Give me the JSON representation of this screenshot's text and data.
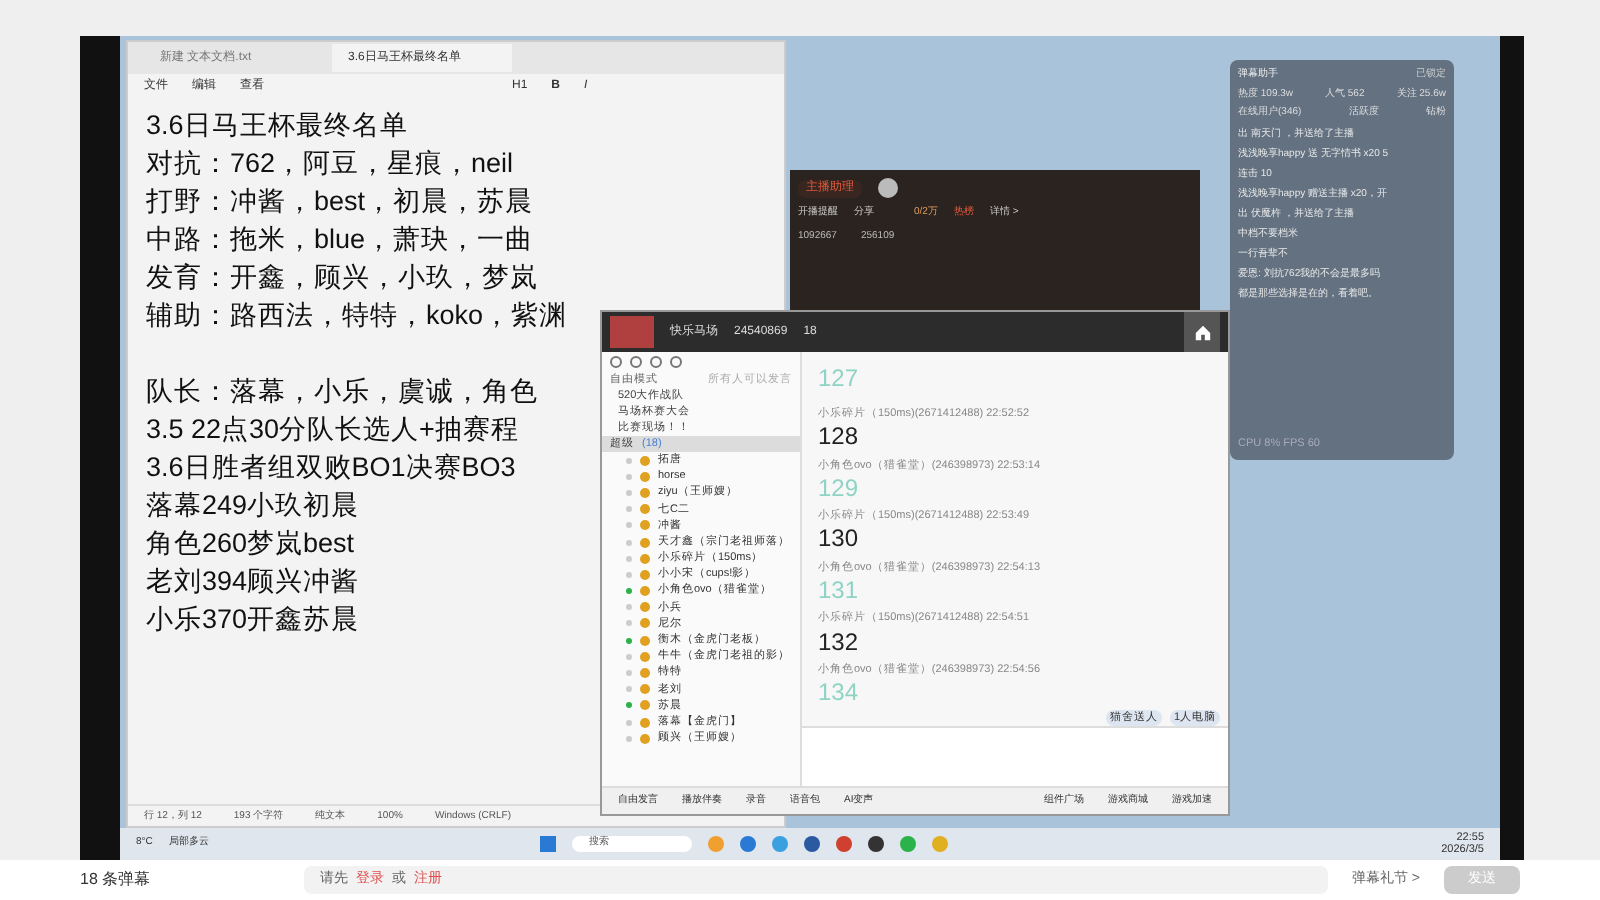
{
  "notepad": {
    "tabs": [
      {
        "label": "新建 文本文档.txt",
        "selected": false
      },
      {
        "label": "3.6日马王杯最终名单",
        "selected": true
      }
    ],
    "menu": [
      "文件",
      "编辑",
      "查看"
    ],
    "toolbar": [
      "H1",
      "B",
      "I"
    ],
    "paragraphs": [
      [
        "3.6日马王杯最终名单",
        "对抗：762，阿豆，星痕，neil",
        "打野：冲酱，best，初晨，苏晨",
        "中路：拖米，blue，萧玦，一曲",
        "发育：开鑫，顾兴，小玖，梦岚",
        "辅助：路西法，特特，koko，紫渊"
      ],
      [
        "队长：落幕，小乐，虞诚，角色",
        "3.5 22点30分队长选人+抽赛程",
        "3.6日胜者组双败BO1决赛BO3",
        "落幕249小玖初晨",
        "角色260梦岚best",
        "老刘394顾兴冲酱",
        "小乐370开鑫苏晨"
      ]
    ],
    "status": [
      "行 12，列 12",
      "193 个字符",
      "纯文本",
      "100%",
      "Windows (CRLF)"
    ]
  },
  "stream_window": {
    "button": "主播助理",
    "links": [
      "开播提醒",
      "分享"
    ],
    "stats": [
      "1092667",
      "256109"
    ],
    "rank": "0/2万",
    "hot": "热榜",
    "detail": "详情 >"
  },
  "chat": {
    "header": {
      "name": "快乐马场",
      "id": "24540869",
      "count": "18"
    },
    "mode": "自由模式",
    "mode_hint": "所有人可以发言",
    "channels": [
      {
        "name": "520大作战队",
        "selected": false
      },
      {
        "name": "马场杯赛大会",
        "selected": false
      },
      {
        "name": "比赛现场！！",
        "selected": false
      },
      {
        "name": "超级",
        "count": "(18)",
        "selected": true
      }
    ],
    "members": [
      {
        "name": "拓唐",
        "speaking": false
      },
      {
        "name": "horse",
        "speaking": false
      },
      {
        "name": "ziyu（王师嫂）",
        "speaking": false
      },
      {
        "name": "七C二",
        "speaking": false
      },
      {
        "name": "冲酱",
        "speaking": false
      },
      {
        "name": "天才鑫（宗门老祖师落）",
        "speaking": false
      },
      {
        "name": "小乐碎片（150ms）",
        "speaking": false
      },
      {
        "name": "小小宋（cups!影）",
        "speaking": false
      },
      {
        "name": "小角色ovo（猎雀堂）",
        "speaking": true
      },
      {
        "name": "小兵",
        "speaking": false
      },
      {
        "name": "尼尔",
        "speaking": false
      },
      {
        "name": "衡木（金虎门老板）",
        "speaking": true
      },
      {
        "name": "牛牛（金虎门老祖的影）",
        "speaking": false
      },
      {
        "name": "特特",
        "speaking": false
      },
      {
        "name": "老刘",
        "speaking": false
      },
      {
        "name": "苏晨",
        "speaking": true
      },
      {
        "name": "落幕【金虎门】",
        "speaking": false
      },
      {
        "name": "顾兴（王师嫂）",
        "speaking": false
      }
    ],
    "messages": [
      {
        "text": "127",
        "color": "#8fd3c4"
      },
      {
        "meta": "小乐碎片（150ms)(2671412488) 22:52:52",
        "text": "128",
        "color": "#222222"
      },
      {
        "meta": "小角色ovo（猎雀堂）(246398973) 22:53:14",
        "text": "129",
        "color": "#8fd3c4"
      },
      {
        "meta": "小乐碎片（150ms)(2671412488) 22:53:49",
        "text": "130",
        "color": "#222222"
      },
      {
        "meta": "小角色ovo（猎雀堂）(246398973) 22:54:13",
        "text": "131",
        "color": "#8fd3c4"
      },
      {
        "meta": "小乐碎片（150ms)(2671412488) 22:54:51",
        "text": "132",
        "color": "#222222"
      },
      {
        "meta": "小角色ovo（猎雀堂）(246398973) 22:54:56",
        "text": "134",
        "color": "#8fd3c4"
      }
    ],
    "avatars": [
      "猫舍送人",
      "1人电脑"
    ],
    "bottom_tools": [
      "自由发言",
      "播放伴奏",
      "录音",
      "语音包",
      "AI变声"
    ],
    "bottom_right": [
      "组件广场",
      "游戏商城",
      "游戏加速"
    ]
  },
  "overlay": {
    "title": "弹幕助手",
    "lock": "已锁定",
    "stats": [
      "热度 109.3w",
      "人气 562",
      "关注 25.6w"
    ],
    "tabs": [
      "在线用户(346)",
      "活跃度",
      "钻粉"
    ],
    "lines": [
      "出 南天门 ，并送给了主播",
      "浅浅晚享happy 送 无字情书 x20 5",
      "连击 10",
      "浅浅晚享happy 赠送主播 x20，开",
      "出 伏魔杵 ，并送给了主播",
      "中档不要档米",
      "一行吾辈不",
      "爱恩: 刘抗762我的不会是最多吗",
      "都是那些选择是在的，看着吧。"
    ],
    "footer": "CPU 8%  FPS 60"
  },
  "taskbar": {
    "weather": "8°C",
    "weather_desc": "局部多云",
    "search": "搜索",
    "time": "22:55",
    "date": "2026/3/5"
  },
  "page": {
    "comment_count": "18 条弹幕",
    "prompt": "请先",
    "login": "登录",
    "or": "或",
    "register": "注册",
    "etiquette": "弹幕礼节 >",
    "send": "发送"
  }
}
